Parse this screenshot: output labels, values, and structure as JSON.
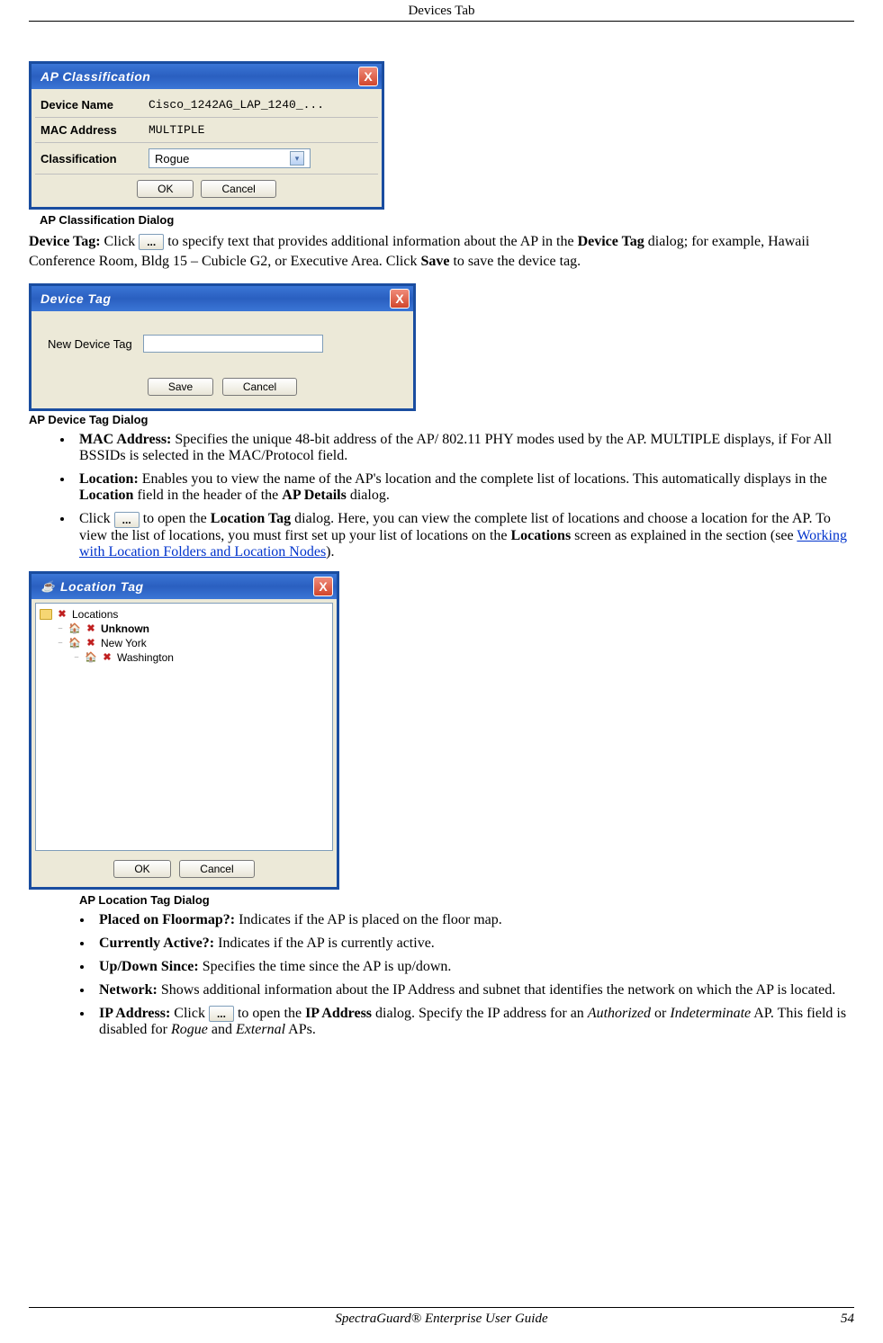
{
  "header": {
    "title": "Devices Tab"
  },
  "dialog1": {
    "title": "AP Classification",
    "close": "X",
    "rows": {
      "deviceName": {
        "label": "Device Name",
        "value": "Cisco_1242AG_LAP_1240_..."
      },
      "mac": {
        "label": "MAC Address",
        "value": "MULTIPLE"
      },
      "classification": {
        "label": "Classification",
        "value": "Rogue"
      }
    },
    "ok": "OK",
    "cancel": "Cancel",
    "caption": "AP Classification Dialog"
  },
  "ellipsis": "...",
  "para1": {
    "lead": "Device Tag: ",
    "p1a": "Click ",
    "p1b": " to specify text that provides additional information about the AP in the ",
    "deviceTag": "Device Tag",
    "p1c": " dialog; for example, Hawaii Conference Room, Bldg 15 – Cubicle G2, or Executive Area. Click ",
    "save": "Save",
    "p1d": " to save the device tag."
  },
  "dialog2": {
    "title": "Device Tag",
    "close": "X",
    "label": "New  Device Tag",
    "input": "",
    "save": "Save",
    "cancel": "Cancel",
    "caption": "AP Device Tag Dialog"
  },
  "bullets1": {
    "mac": {
      "lead": "MAC Address: ",
      "text": "Specifies the unique 48-bit address of the AP/ 802.11 PHY modes used by the AP. MULTIPLE displays, if For All BSSIDs is selected in the MAC/Protocol field."
    },
    "loc": {
      "lead": "Location: ",
      "textA": "Enables you to view the name of the AP's location and the complete list of locations. This automatically displays in the ",
      "b1": "Location",
      "textB": " field in the header of the ",
      "b2": "AP Details",
      "textC": " dialog."
    },
    "click": {
      "t1": "Click ",
      "t2": " to open the ",
      "b1": "Location Tag",
      "t3": " dialog. Here, you can view the complete list of locations and choose a location for the AP. To view the list of locations, you must first set up your list of locations on the ",
      "b2": "Locations",
      "t4": " screen as explained in the section (see ",
      "link": "Working with Location Folders and Location Nodes",
      "t5": ")."
    }
  },
  "dialog3": {
    "title": "Location Tag",
    "close": "X",
    "tree": {
      "root": "Locations",
      "unknown": "Unknown",
      "ny": "New York",
      "wa": "Washington"
    },
    "ok": "OK",
    "cancel": "Cancel",
    "caption": "AP Location Tag Dialog"
  },
  "bullets2": {
    "floormap": {
      "lead": "Placed on Floormap?: ",
      "text": "Indicates if the AP is placed on the floor map."
    },
    "active": {
      "lead": "Currently Active?: ",
      "text": "Indicates if the AP is currently active."
    },
    "upDown": {
      "lead": "Up/Down Since: ",
      "text": "Specifies the time since the AP is up/down."
    },
    "network": {
      "lead": "Network: ",
      "text": "Shows additional information about the IP Address and subnet that identifies the network on which the AP is located."
    },
    "ip": {
      "lead": "IP Address: ",
      "t1": "Click ",
      "t2": " to open the ",
      "b1": "IP Address",
      "t3": " dialog. Specify the IP address for an ",
      "i1": "Authorized",
      "t4": " or ",
      "i2": "Indeterminate",
      "t5": " AP. This field is disabled for ",
      "i3": "Rogue",
      "t6": " and ",
      "i4": "External",
      "t7": " APs."
    }
  },
  "footer": {
    "guide": "SpectraGuard®  Enterprise User Guide",
    "page": "54"
  }
}
